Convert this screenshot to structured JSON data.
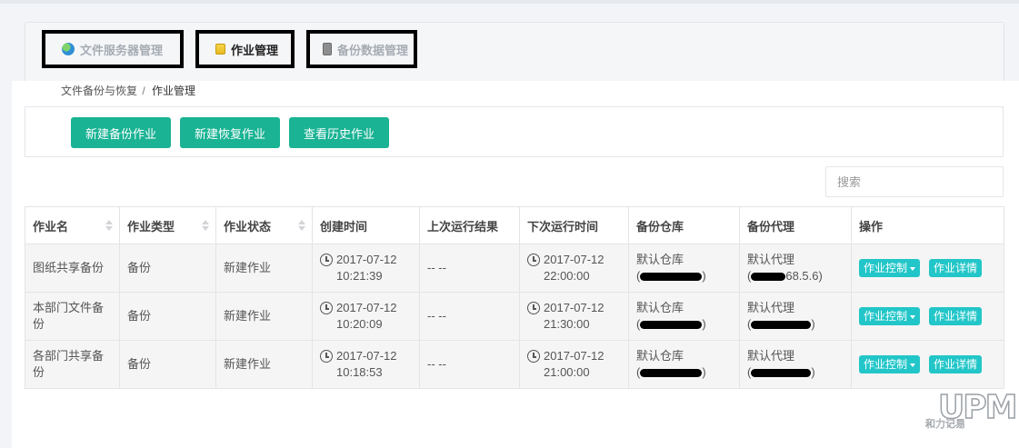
{
  "tabs": [
    {
      "label": "文件服务器管理",
      "icon": "globe-icon",
      "active": false
    },
    {
      "label": "作业管理",
      "icon": "notepad-icon",
      "active": true
    },
    {
      "label": "备份数据管理",
      "icon": "cabinet-icon",
      "active": false
    }
  ],
  "breadcrumb": {
    "parent": "文件备份与恢复",
    "separator": "/",
    "current": "作业管理"
  },
  "actions": {
    "new_backup": "新建备份作业",
    "new_restore": "新建恢复作业",
    "history": "查看历史作业"
  },
  "search": {
    "placeholder": "搜索",
    "value": ""
  },
  "table": {
    "headers": [
      "作业名",
      "作业类型",
      "作业状态",
      "创建时间",
      "上次运行结果",
      "下次运行时间",
      "备份仓库",
      "备份代理",
      "操作"
    ],
    "rows": [
      {
        "name": "图纸共享备份",
        "type": "备份",
        "status": "新建作业",
        "created_date": "2017-07-12",
        "created_time": "10:21:39",
        "last_result": "-- --",
        "next_date": "2017-07-12",
        "next_time": "22:00:00",
        "repo": "默认仓库",
        "agent": "默认代理",
        "agent_ip_tail": "68.5.6)"
      },
      {
        "name": "本部门文件备份",
        "type": "备份",
        "status": "新建作业",
        "created_date": "2017-07-12",
        "created_time": "10:20:09",
        "last_result": "-- --",
        "next_date": "2017-07-12",
        "next_time": "21:30:00",
        "repo": "默认仓库",
        "agent": "默认代理",
        "agent_ip_tail": ""
      },
      {
        "name": "各部门共享备份",
        "type": "备份",
        "status": "新建作业",
        "created_date": "2017-07-12",
        "created_time": "10:18:53",
        "last_result": "-- --",
        "next_date": "2017-07-12",
        "next_time": "21:00:00",
        "repo": "默认仓库",
        "agent": "默认代理",
        "agent_ip_tail": ""
      }
    ],
    "op_control": "作业控制",
    "op_detail": "作业详情"
  },
  "watermark": {
    "logo": "UPM",
    "text": "和力记易"
  },
  "colors": {
    "primary": "#1ab394",
    "info": "#23c6c8"
  }
}
